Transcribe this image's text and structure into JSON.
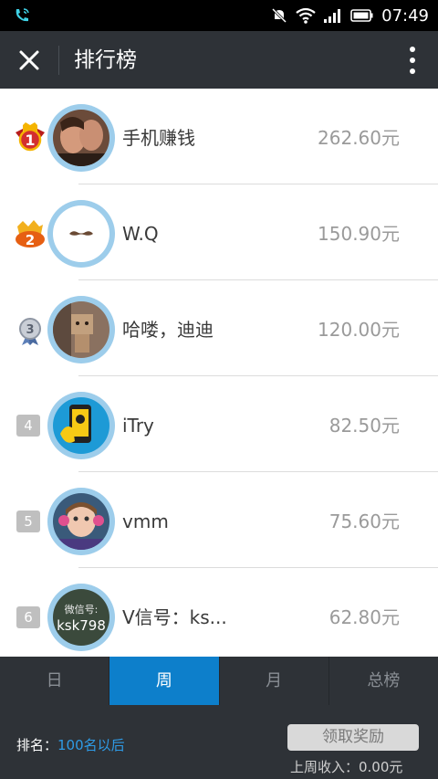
{
  "status_bar": {
    "time": "07:49",
    "icons": [
      "phone-icon",
      "mute-icon",
      "wifi-icon",
      "signal-icon",
      "battery-icon"
    ]
  },
  "header": {
    "title": "排行榜",
    "close_icon": "close-icon",
    "more_icon": "more-vertical-icon"
  },
  "ranking": [
    {
      "rank": "1",
      "badge": "gold-medal-icon",
      "name": "手机赚钱",
      "amount": "262.60元"
    },
    {
      "rank": "2",
      "badge": "silver-medal-icon",
      "name": "W.Q",
      "amount": "150.90元"
    },
    {
      "rank": "3",
      "badge": "bronze-medal-icon",
      "name": "哈喽，迪迪",
      "amount": "120.00元"
    },
    {
      "rank": "4",
      "name": "iTry",
      "amount": "82.50元"
    },
    {
      "rank": "5",
      "name": "vmm",
      "amount": "75.60元"
    },
    {
      "rank": "6",
      "name": "V信号：ks...",
      "amount": "62.80元",
      "avatar_text": [
        "微信号:",
        "ksk798"
      ]
    }
  ],
  "tabs": [
    {
      "label": "日",
      "active": false
    },
    {
      "label": "周",
      "active": true
    },
    {
      "label": "月",
      "active": false
    },
    {
      "label": "总榜",
      "active": false
    }
  ],
  "footer": {
    "rank_label": "排名：",
    "rank_value": "100名以后",
    "claim_button": "领取奖励",
    "last_week_income": "上周收入：0.00元"
  },
  "colors": {
    "accent": "#0d7fcb",
    "header_bg": "#2e3237",
    "avatar_ring": "#9dcdeb"
  }
}
